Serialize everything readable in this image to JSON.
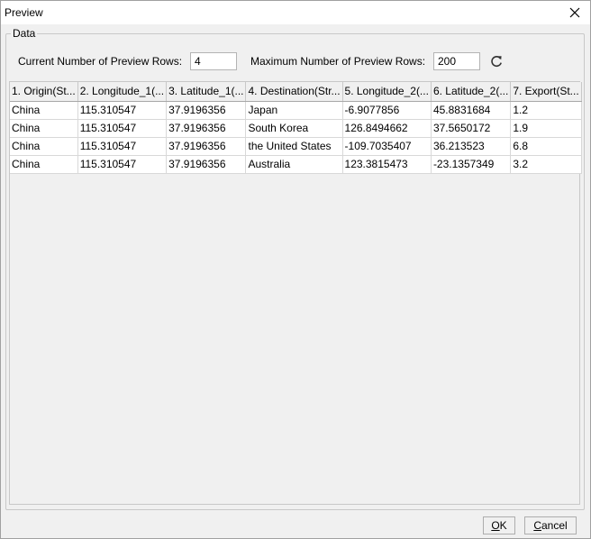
{
  "window": {
    "title": "Preview"
  },
  "group": {
    "legend": "Data"
  },
  "controls": {
    "current_label": "Current Number of Preview Rows:",
    "current_value": "4",
    "max_label": "Maximum Number of Preview Rows:",
    "max_value": "200"
  },
  "table": {
    "columns": [
      "1. Origin(St...",
      "2. Longitude_1(...",
      "3. Latitude_1(...",
      "4. Destination(Str...",
      "5. Longitude_2(...",
      "6. Latitude_2(...",
      "7. Export(St..."
    ],
    "rows": [
      [
        "China",
        "115.310547",
        "37.9196356",
        "Japan",
        "-6.9077856",
        "45.8831684",
        "1.2"
      ],
      [
        "China",
        "115.310547",
        "37.9196356",
        "South Korea",
        "126.8494662",
        "37.5650172",
        "1.9"
      ],
      [
        "China",
        "115.310547",
        "37.9196356",
        "the United States",
        "-109.7035407",
        "36.213523",
        "6.8"
      ],
      [
        "China",
        "115.310547",
        "37.9196356",
        "Australia",
        "123.3815473",
        "-23.1357349",
        "3.2"
      ]
    ]
  },
  "buttons": {
    "ok_mnemonic": "O",
    "ok_rest": "K",
    "cancel_mnemonic": "C",
    "cancel_rest": "ancel"
  },
  "icons": {
    "close": "close-icon",
    "refresh": "refresh-icon"
  }
}
